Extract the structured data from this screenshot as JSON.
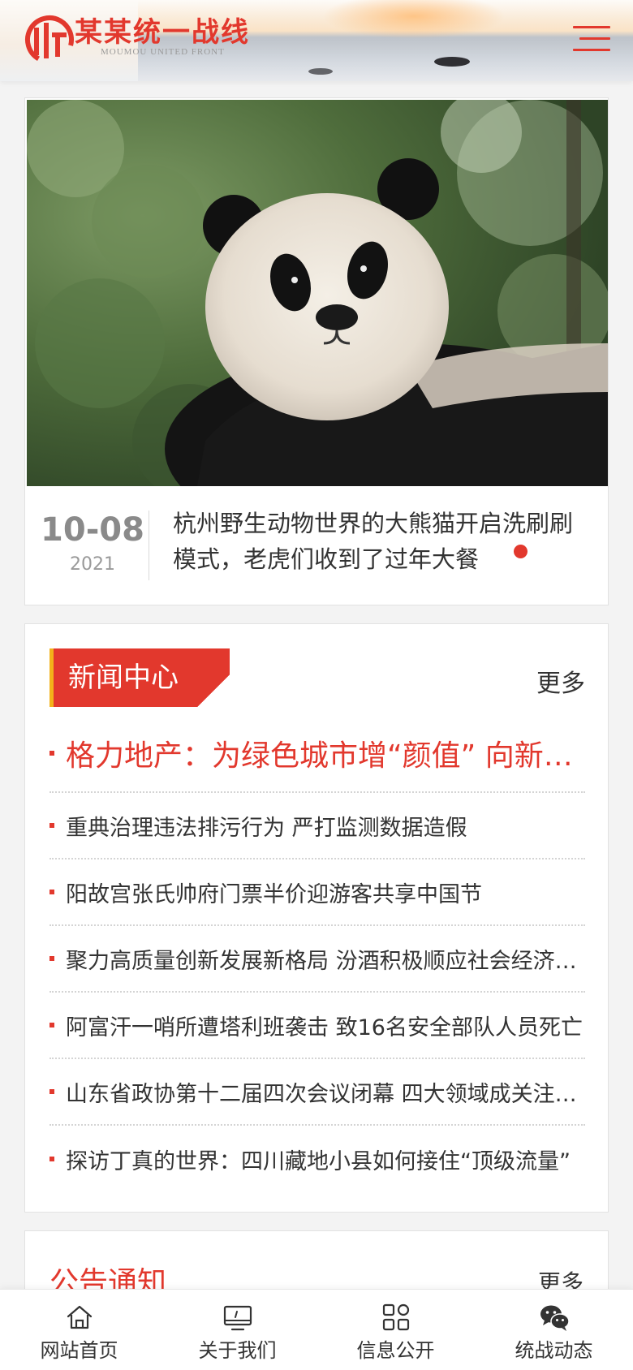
{
  "header": {
    "logo_title": "某某统一战线",
    "logo_subtitle": "MOUMOU UNITED FRONT"
  },
  "slider": {
    "date_day": "10-08",
    "date_year": "2021",
    "title": "杭州野生动物世界的大熊猫开启洗刷刷模式，老虎们收到了过年大餐"
  },
  "news": {
    "section_title": "新闻中心",
    "more_label": "更多",
    "items": [
      "格力地产：为绿色城市增“颜值” 向新兴产业要“价值”",
      "重典治理违法排污行为 严打监测数据造假",
      "阳故宫张氏帅府门票半价迎游客共享中国节",
      "聚力高质量创新发展新格局 汾酒积极顺应社会经济发展",
      "阿富汗一哨所遭塔利班袭击 致16名安全部队人员死亡",
      "山东省政协第十二届四次会议闭幕 四大领域成关注焦点",
      "探访丁真的世界：四川藏地小县如何接住“顶级流量”"
    ]
  },
  "notice": {
    "section_title": "公告通知",
    "more_label": "更多"
  },
  "bottom_nav": {
    "items": [
      {
        "label": "网站首页",
        "icon": "home-icon"
      },
      {
        "label": "关于我们",
        "icon": "monitor-icon"
      },
      {
        "label": "信息公开",
        "icon": "grid-icon"
      },
      {
        "label": "统战动态",
        "icon": "wechat-icon"
      }
    ]
  },
  "colors": {
    "accent": "#e2382d",
    "tab_stripe": "#f3b21a"
  }
}
